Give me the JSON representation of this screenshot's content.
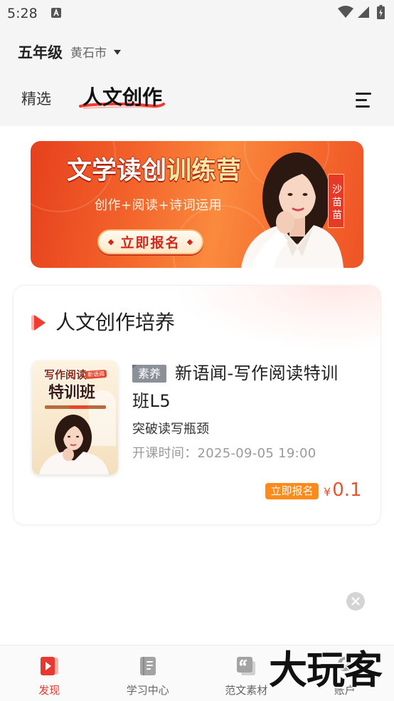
{
  "status_bar": {
    "time": "5:28",
    "icons": [
      "notification-a-icon",
      "wifi-icon",
      "signal-icon",
      "battery-icon"
    ]
  },
  "header": {
    "grade": "五年级",
    "city": "黄石市",
    "city_icon": "caret-down-icon"
  },
  "tabs": [
    {
      "label": "精选",
      "active": false
    },
    {
      "label": "人文创作",
      "active": true
    }
  ],
  "tabs_menu_icon": "menu-icon",
  "banner": {
    "title_main": "文学读创",
    "title_accent": "训练营",
    "subtitle": "创作+阅读+诗词运用",
    "cta": "立即报名",
    "teacher": "沙苗苗"
  },
  "section": {
    "icon": "section-play-icon",
    "title": "人文创作培养"
  },
  "course": {
    "cover": {
      "line1": "写作阅读",
      "badge": "新语闻",
      "line2": "特训班"
    },
    "tag": "素养",
    "title": "新语闻-写作阅读特训班L5",
    "subtitle": "突破读写瓶颈",
    "start_time": "开课时间：2025-09-05 19:00",
    "cta": "立即报名",
    "currency": "¥",
    "price": "0.1"
  },
  "close_icon": "close-icon",
  "bottom_nav": [
    {
      "label": "发现",
      "icon": "discover-play-icon",
      "active": true
    },
    {
      "label": "学习中心",
      "icon": "book-icon",
      "active": false
    },
    {
      "label": "范文素材",
      "icon": "quote-icon",
      "active": false
    },
    {
      "label": "账户",
      "icon": "user-icon",
      "active": false
    }
  ],
  "watermark": "大玩客",
  "colors": {
    "accent_red": "#e8382f",
    "cta_orange": "#ff8a1c",
    "price_red": "#f2502a",
    "banner_orange": "#f26a2e",
    "tag_gray": "#8c9099"
  }
}
